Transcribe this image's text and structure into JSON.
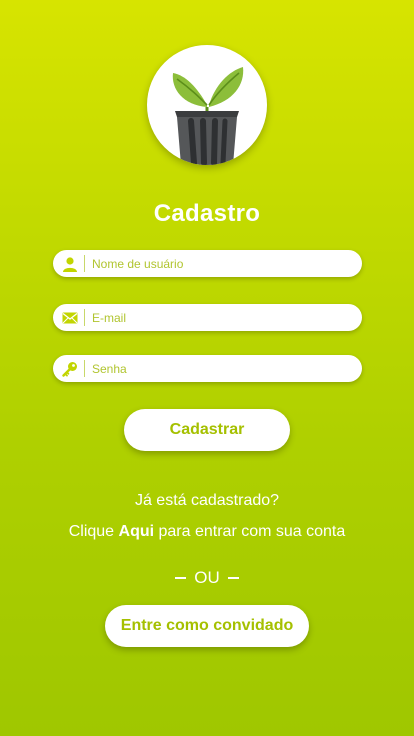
{
  "screen": {
    "title": "Cadastro"
  },
  "logo": {
    "icon": "plant-pot-icon"
  },
  "form": {
    "username": {
      "icon": "user-icon",
      "placeholder": "Nome de usuário",
      "value": ""
    },
    "email": {
      "icon": "envelope-icon",
      "placeholder": "E-mail",
      "value": ""
    },
    "password": {
      "icon": "key-icon",
      "placeholder": "Senha",
      "value": ""
    },
    "submit_label": "Cadastrar"
  },
  "login_prompt": {
    "question": "Já está cadastrado?",
    "prefix": "Clique ",
    "link": "Aqui",
    "suffix": " para entrar com sua conta"
  },
  "divider": {
    "label": "OU"
  },
  "guest": {
    "label": "Entre como convidado"
  },
  "colors": {
    "gradient_top": "#d7e400",
    "gradient_bottom": "#9fc700",
    "accent": "#a5c000",
    "icon": "#c2d500"
  }
}
